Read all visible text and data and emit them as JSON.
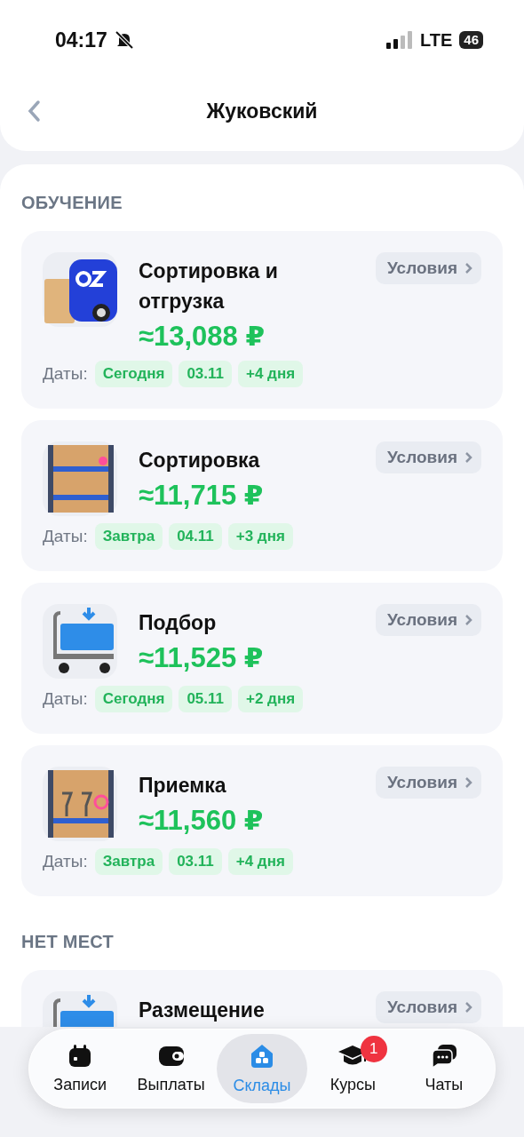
{
  "status_bar": {
    "time": "04:17",
    "network": "LTE",
    "battery": "46"
  },
  "header": {
    "title": "Жуковский"
  },
  "sections": [
    {
      "title": "ОБУЧЕНИЕ",
      "cards": [
        {
          "kind": "van",
          "title": "Сортировка и отгрузка",
          "price": "≈13,088 ₽",
          "dates_label": "Даты:",
          "dates": [
            "Сегодня",
            "03.11",
            "+4 дня"
          ],
          "button": "Условия"
        },
        {
          "kind": "shelf_boxes",
          "title": "Сортировка",
          "price": "≈11,715 ₽",
          "dates_label": "Даты:",
          "dates": [
            "Завтра",
            "04.11",
            "+3 дня"
          ],
          "button": "Условия"
        },
        {
          "kind": "cart",
          "title": "Подбор",
          "price": "≈11,525 ₽",
          "dates_label": "Даты:",
          "dates": [
            "Сегодня",
            "05.11",
            "+2 дня"
          ],
          "button": "Условия"
        },
        {
          "kind": "shelf_glasses",
          "title": "Приемка",
          "price": "≈11,560 ₽",
          "dates_label": "Даты:",
          "dates": [
            "Завтра",
            "03.11",
            "+4 дня"
          ],
          "button": "Условия"
        }
      ]
    },
    {
      "title": "НЕТ МЕСТ",
      "cards": [
        {
          "kind": "cart",
          "title": "Размещение",
          "button": "Условия"
        }
      ]
    }
  ],
  "tab_bar": [
    {
      "label": "Записи",
      "selected": false
    },
    {
      "label": "Выплаты",
      "selected": false
    },
    {
      "label": "Склады",
      "selected": true
    },
    {
      "label": "Курсы",
      "selected": false,
      "badge": "1"
    },
    {
      "label": "Чаты",
      "selected": false
    }
  ]
}
